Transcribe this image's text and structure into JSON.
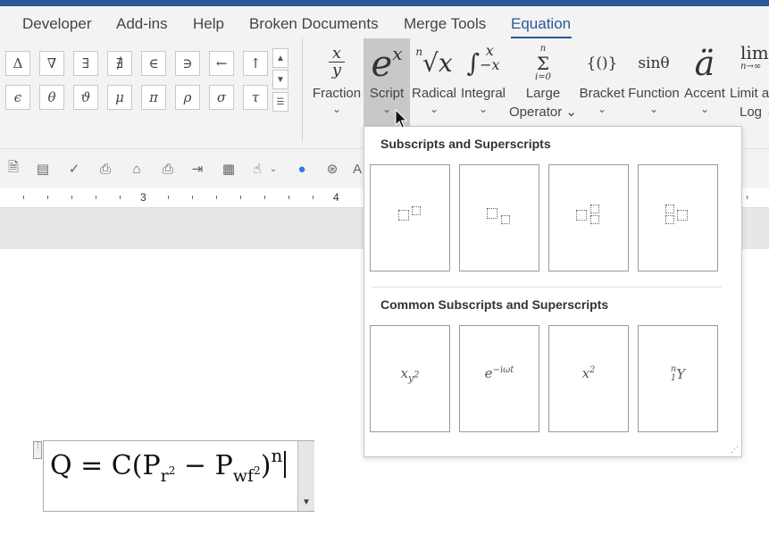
{
  "ribbon_tabs": [
    {
      "label": "Developer",
      "active": false
    },
    {
      "label": "Add-ins",
      "active": false
    },
    {
      "label": "Help",
      "active": false
    },
    {
      "label": "Broken Documents",
      "active": false
    },
    {
      "label": "Merge Tools",
      "active": false
    },
    {
      "label": "Equation",
      "active": true
    }
  ],
  "symbols_row1": [
    "Δ",
    "∇",
    "∃",
    "∄",
    "∈",
    "∋",
    "←",
    "↑"
  ],
  "symbols_row2": [
    "ϵ",
    "θ",
    "ϑ",
    "μ",
    "π",
    "ρ",
    "σ",
    "τ"
  ],
  "structures": [
    {
      "name": "fraction",
      "label": "Fraction"
    },
    {
      "name": "script",
      "label": "Script"
    },
    {
      "name": "radical",
      "label": "Radical"
    },
    {
      "name": "integral",
      "label": "Integral"
    },
    {
      "name": "large-operator",
      "label_line1": "Large",
      "label_line2": "Operator"
    },
    {
      "name": "bracket",
      "label": "Bracket"
    },
    {
      "name": "function",
      "label": "Function"
    },
    {
      "name": "accent",
      "label": "Accent"
    },
    {
      "name": "limit-log",
      "label_line1": "Limit a",
      "label_line2": "Log"
    }
  ],
  "struct_icons": {
    "fraction_num": "x",
    "fraction_den": "y",
    "script_base": "e",
    "script_sup": "x",
    "radical_index": "n",
    "radical_body": "√x",
    "integral": "∫",
    "integral_upper": "x",
    "integral_lower": "−x",
    "sum_upper": "n",
    "sum_sym": "Σ",
    "sum_lower": "i=0",
    "bracket": "{()}",
    "function": "sinθ",
    "accent": "ä",
    "limit": "lim",
    "limit_sub": "n→∞"
  },
  "ruler": {
    "marks": [
      "3",
      "4"
    ]
  },
  "equation": {
    "lhs": "Q = C(P",
    "sub1": "r",
    "sup1": "2",
    "mid": " − P",
    "sub2": "wf",
    "sup2": "2",
    "close": ")",
    "exp": "n"
  },
  "dropdown": {
    "section1_title": "Subscripts and Superscripts",
    "section2_title": "Common Subscripts and Superscripts",
    "common": [
      {
        "base": "x",
        "sub": "y",
        "subsup": "2"
      },
      {
        "base": "e",
        "sup": "−iωt"
      },
      {
        "base": "x",
        "sup": "2"
      },
      {
        "pre_sup": "n",
        "pre_sub": "1",
        "base": "Y"
      }
    ]
  },
  "colors": {
    "accent": "#2b579a",
    "ribbon_bg": "#f3f3f3"
  }
}
